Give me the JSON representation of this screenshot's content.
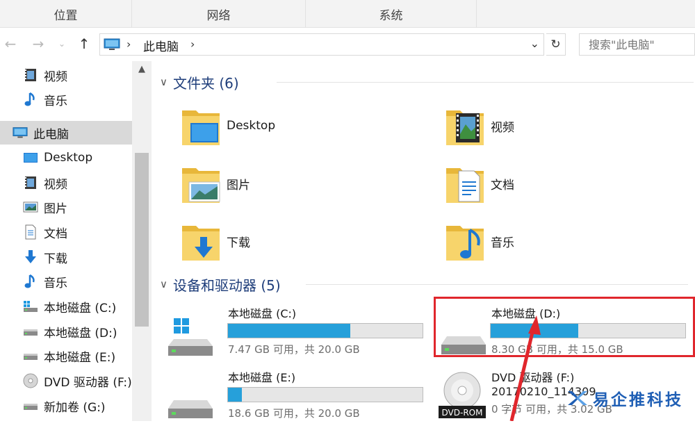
{
  "ribbon": {
    "groups": [
      "位置",
      "网络",
      "系统"
    ]
  },
  "address": {
    "crumb": "此电脑"
  },
  "search": {
    "placeholder": "搜索\"此电脑\""
  },
  "sidebar": {
    "items": [
      {
        "label": "视频",
        "icon": "video-icon"
      },
      {
        "label": "音乐",
        "icon": "music-icon"
      },
      {
        "label": "此电脑",
        "icon": "pc-icon",
        "selected": true
      },
      {
        "label": "Desktop",
        "icon": "desktop-icon"
      },
      {
        "label": "视频",
        "icon": "video-icon"
      },
      {
        "label": "图片",
        "icon": "picture-icon"
      },
      {
        "label": "文档",
        "icon": "document-icon"
      },
      {
        "label": "下载",
        "icon": "download-icon"
      },
      {
        "label": "音乐",
        "icon": "music-icon"
      },
      {
        "label": "本地磁盘 (C:)",
        "icon": "system-drive-icon"
      },
      {
        "label": "本地磁盘 (D:)",
        "icon": "drive-icon"
      },
      {
        "label": "本地磁盘 (E:)",
        "icon": "drive-icon"
      },
      {
        "label": "DVD 驱动器 (F:)",
        "icon": "dvd-icon"
      },
      {
        "label": "新加卷 (G:)",
        "icon": "drive-icon"
      }
    ]
  },
  "folders_group": {
    "title": "文件夹 (6)"
  },
  "folders": [
    {
      "label": "Desktop",
      "icon": "desktop-folder-icon"
    },
    {
      "label": "视频",
      "icon": "video-folder-icon"
    },
    {
      "label": "图片",
      "icon": "picture-folder-icon"
    },
    {
      "label": "文档",
      "icon": "document-folder-icon"
    },
    {
      "label": "下载",
      "icon": "download-folder-icon"
    },
    {
      "label": "音乐",
      "icon": "music-folder-icon"
    }
  ],
  "drives_group": {
    "title": "设备和驱动器 (5)"
  },
  "drives": [
    {
      "name": "本地磁盘 (C:)",
      "info": "7.47 GB 可用，共 20.0 GB",
      "used_fraction": 0.63,
      "icon": "system-drive-icon"
    },
    {
      "name": "本地磁盘 (D:)",
      "info": "8.30 GB 可用，共 15.0 GB",
      "used_fraction": 0.45,
      "icon": "drive-icon",
      "highlighted": true
    },
    {
      "name": "本地磁盘 (E:)",
      "info": "18.6 GB 可用，共 20.0 GB",
      "used_fraction": 0.07,
      "icon": "drive-icon"
    },
    {
      "name": "DVD 驱动器 (F:)",
      "info_line1": "20170210_114309",
      "info_line2": "0 字节 可用，共 3.02 GB",
      "icon": "dvd-rom-icon",
      "badge": "DVD-ROM"
    }
  ],
  "watermark": {
    "text": "易企推科技",
    "icon": "logo-icon"
  },
  "colors": {
    "accent": "#26a0da",
    "highlight": "#e0262c",
    "selected_bg": "#d9d9d9",
    "group_title": "#1e3d7a"
  }
}
